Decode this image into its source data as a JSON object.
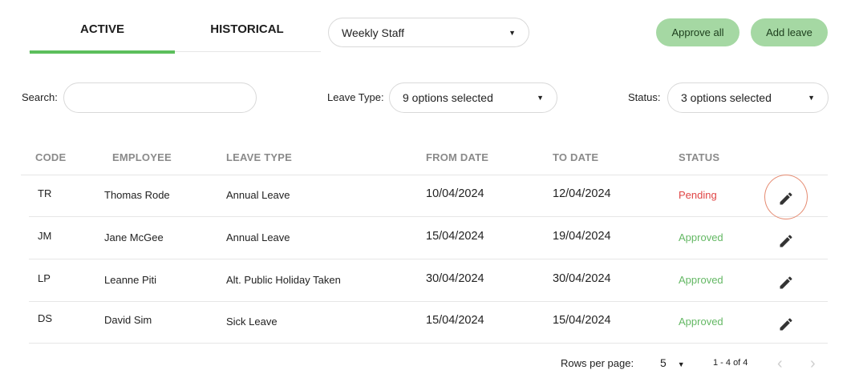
{
  "tabs": {
    "active_label": "ACTIVE",
    "historical_label": "HISTORICAL"
  },
  "staff_select": {
    "value": "Weekly Staff"
  },
  "buttons": {
    "approve_all": "Approve all",
    "add_leave": "Add leave"
  },
  "filters": {
    "search_label": "Search:",
    "search_value": "",
    "leave_type_label": "Leave Type:",
    "leave_type_value": "9 options selected",
    "status_label": "Status:",
    "status_value": "3 options selected"
  },
  "table": {
    "headers": {
      "code": "CODE",
      "employee": "EMPLOYEE",
      "leave_type": "LEAVE TYPE",
      "from_date": "FROM DATE",
      "to_date": "TO DATE",
      "status": "STATUS"
    },
    "rows": [
      {
        "code": "TR",
        "employee": "Thomas Rode",
        "leave_type": "Annual Leave",
        "from_date": "10/04/2024",
        "to_date": "12/04/2024",
        "status": "Pending",
        "status_color": "#e04545"
      },
      {
        "code": "JM",
        "employee": "Jane McGee",
        "leave_type": "Annual Leave",
        "from_date": "15/04/2024",
        "to_date": "19/04/2024",
        "status": "Approved",
        "status_color": "#64b864"
      },
      {
        "code": "LP",
        "employee": "Leanne Piti",
        "leave_type": "Alt. Public Holiday Taken",
        "from_date": "30/04/2024",
        "to_date": "30/04/2024",
        "status": "Approved",
        "status_color": "#64b864"
      },
      {
        "code": "DS",
        "employee": "David Sim",
        "leave_type": "Sick Leave",
        "from_date": "15/04/2024",
        "to_date": "15/04/2024",
        "status": "Approved",
        "status_color": "#64b864"
      }
    ]
  },
  "pagination": {
    "rows_per_page_label": "Rows per page:",
    "rows_per_page_value": "5",
    "range": "1 - 4 of 4"
  },
  "icons": {
    "edit": "pencil-icon",
    "dropdown": "caret-down-icon",
    "prev": "chevron-left-icon",
    "next": "chevron-right-icon"
  },
  "colors": {
    "accent": "#5cbf5c",
    "button_bg": "#a5d8a3",
    "pending": "#e04545",
    "approved": "#64b864"
  }
}
